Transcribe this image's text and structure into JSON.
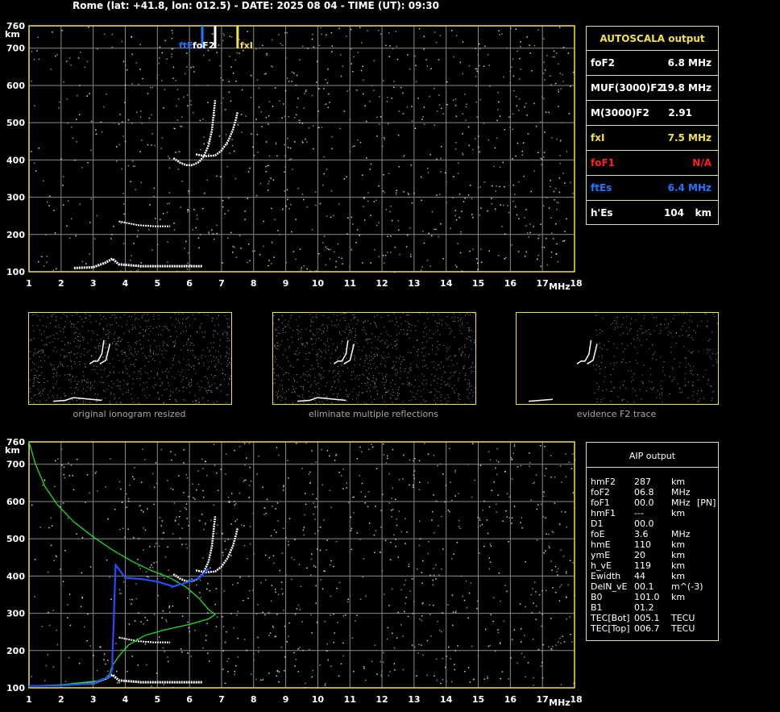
{
  "header": {
    "title": "Rome (lat: +41.8, lon: 012.5) - DATE: 2025 08 04 - TIME (UT): 09:30"
  },
  "chart_data": [
    {
      "type": "scatter",
      "name": "ionogram",
      "xlabel": "MHz",
      "ylabel": "km",
      "xlim": [
        1,
        18
      ],
      "ylim": [
        100,
        760
      ],
      "x_ticks": [
        1,
        2,
        3,
        4,
        5,
        6,
        7,
        8,
        9,
        10,
        11,
        12,
        13,
        14,
        15,
        16,
        17,
        18
      ],
      "y_ticks": [
        100,
        200,
        300,
        400,
        500,
        600,
        700,
        760
      ],
      "grid": true,
      "markers": [
        {
          "label": "ftE",
          "x": 6.4,
          "color": "#1e78ff"
        },
        {
          "label": "foF2",
          "x": 6.8,
          "color": "#ffffff"
        },
        {
          "label": "fxI",
          "x": 7.5,
          "color": "#f2e04a"
        }
      ],
      "traces": {
        "F2_o": [
          [
            5.5,
            405
          ],
          [
            5.7,
            393
          ],
          [
            5.9,
            386
          ],
          [
            6.1,
            386
          ],
          [
            6.3,
            395
          ],
          [
            6.45,
            410
          ],
          [
            6.6,
            440
          ],
          [
            6.7,
            480
          ],
          [
            6.75,
            520
          ],
          [
            6.8,
            560
          ]
        ],
        "F2_x": [
          [
            6.2,
            415
          ],
          [
            6.5,
            410
          ],
          [
            6.8,
            412
          ],
          [
            7.0,
            425
          ],
          [
            7.2,
            450
          ],
          [
            7.35,
            480
          ],
          [
            7.45,
            510
          ],
          [
            7.5,
            530
          ]
        ],
        "Es": [
          [
            2.4,
            110
          ],
          [
            3.0,
            112
          ],
          [
            3.4,
            125
          ],
          [
            3.6,
            135
          ],
          [
            3.8,
            120
          ],
          [
            4.5,
            115
          ],
          [
            5.0,
            115
          ],
          [
            5.5,
            115
          ],
          [
            6.0,
            115
          ],
          [
            6.4,
            115
          ]
        ],
        "E_sparse": [
          [
            3.8,
            235
          ],
          [
            4.4,
            225
          ],
          [
            4.9,
            222
          ],
          [
            5.4,
            222
          ]
        ]
      }
    },
    {
      "type": "line",
      "name": "aip-profile",
      "xlabel": "MHz",
      "ylabel": "km",
      "xlim": [
        1,
        18
      ],
      "ylim": [
        100,
        760
      ],
      "profile": [
        [
          1,
          760
        ],
        [
          1.2,
          700
        ],
        [
          1.5,
          640
        ],
        [
          1.9,
          590
        ],
        [
          2.4,
          545
        ],
        [
          3.0,
          505
        ],
        [
          3.6,
          470
        ],
        [
          4.2,
          440
        ],
        [
          4.8,
          415
        ],
        [
          5.4,
          395
        ],
        [
          5.9,
          370
        ],
        [
          6.3,
          340
        ],
        [
          6.6,
          310
        ],
        [
          6.8,
          297
        ],
        [
          6.6,
          285
        ],
        [
          6.0,
          270
        ],
        [
          5.2,
          255
        ],
        [
          4.6,
          240
        ],
        [
          4.1,
          215
        ],
        [
          3.8,
          185
        ],
        [
          3.6,
          160
        ],
        [
          3.5,
          135
        ],
        [
          3.3,
          120
        ],
        [
          2.0,
          108
        ],
        [
          1.0,
          105
        ]
      ],
      "fitted_trace": [
        [
          1,
          105
        ],
        [
          2,
          106
        ],
        [
          3,
          112
        ],
        [
          3.5,
          130
        ],
        [
          3.6,
          150
        ],
        [
          3.6,
          180
        ],
        [
          3.7,
          430
        ],
        [
          4.0,
          395
        ],
        [
          4.5,
          392
        ],
        [
          5.0,
          385
        ],
        [
          5.5,
          372
        ],
        [
          6.0,
          385
        ],
        [
          6.3,
          395
        ],
        [
          6.6,
          420
        ]
      ]
    }
  ],
  "autoscala": {
    "title": "AUTOSCALA output",
    "rows": [
      {
        "label": "foF2",
        "value": "6.8 MHz",
        "color": "#ffffff"
      },
      {
        "label": "MUF(3000)F2",
        "value": "19.8 MHz",
        "color": "#ffffff"
      },
      {
        "label": "M(3000)F2",
        "value": "2.91",
        "color": "#ffffff"
      },
      {
        "label": "fxI",
        "value": "7.5 MHz",
        "color": "#f2e04a"
      },
      {
        "label": "foF1",
        "value": "N/A",
        "color": "#ff2020"
      },
      {
        "label": "ftEs",
        "value": "6.4 MHz",
        "color": "#1e78ff"
      },
      {
        "label": "h'Es",
        "value": "104",
        "unit": "km",
        "color": "#ffffff"
      }
    ]
  },
  "aip": {
    "title": "AIP output",
    "rows": [
      {
        "name": "hmF2",
        "value": "287",
        "unit": "km",
        "extra": ""
      },
      {
        "name": "foF2",
        "value": "06.8",
        "unit": "MHz",
        "extra": ""
      },
      {
        "name": "foF1",
        "value": "00.0",
        "unit": "MHz",
        "extra": "[PN]"
      },
      {
        "name": "hmF1",
        "value": "---",
        "unit": "km",
        "extra": ""
      },
      {
        "name": "D1",
        "value": "00.0",
        "unit": "",
        "extra": ""
      },
      {
        "name": "foE",
        "value": "3.6",
        "unit": "MHz",
        "extra": ""
      },
      {
        "name": "hmE",
        "value": "110",
        "unit": "km",
        "extra": ""
      },
      {
        "name": "ymE",
        "value": "20",
        "unit": "km",
        "extra": ""
      },
      {
        "name": "h_vE",
        "value": "119",
        "unit": "km",
        "extra": ""
      },
      {
        "name": "Ewidth",
        "value": "44",
        "unit": "km",
        "extra": ""
      },
      {
        "name": "DelN_vE",
        "value": "00.1",
        "unit": "m^(-3)",
        "extra": ""
      },
      {
        "name": "B0",
        "value": "101.0",
        "unit": "km",
        "extra": ""
      },
      {
        "name": "B1",
        "value": "01.2",
        "unit": "",
        "extra": ""
      },
      {
        "name": "TEC[Bot]",
        "value": "005.1",
        "unit": "TECU",
        "extra": ""
      },
      {
        "name": "TEC[Top]",
        "value": "006.7",
        "unit": "TECU",
        "extra": ""
      }
    ]
  },
  "thumbnails": [
    {
      "caption": "original ionogram resized"
    },
    {
      "caption": "eliminate multiple reflections"
    },
    {
      "caption": "evidence F2 trace"
    }
  ],
  "colors": {
    "frame": "#f2e04a",
    "grid": "#8a8a8a",
    "panel_border": "#cfe8a8",
    "profile": "#22dd22",
    "fit": "#1e50ff"
  }
}
